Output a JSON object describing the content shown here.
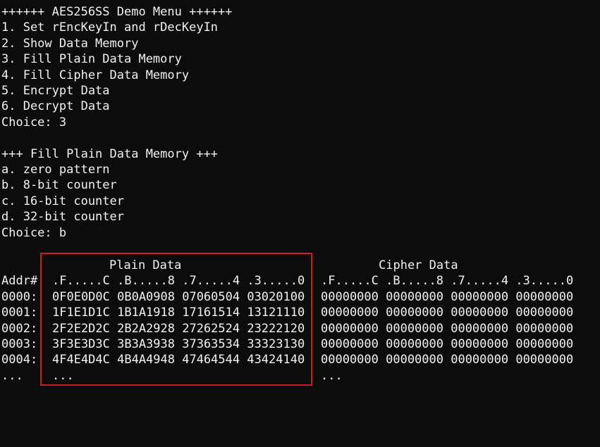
{
  "menu": {
    "title": "++++++ AES256SS Demo Menu ++++++",
    "items": [
      "1. Set rEncKeyIn and rDecKeyIn",
      "2. Show Data Memory",
      "3. Fill Plain Data Memory",
      "4. Fill Cipher Data Memory",
      "5. Encrypt Data",
      "6. Decrypt Data"
    ],
    "choice": "Choice: 3"
  },
  "submenu": {
    "title": "+++ Fill Plain Data Memory +++",
    "items": [
      "a. zero pattern",
      "b. 8-bit counter",
      "c. 16-bit counter",
      "d. 32-bit counter"
    ],
    "choice": "Choice: b"
  },
  "memory": {
    "plain_title": "Plain Data",
    "cipher_title": "Cipher Data",
    "addr_header": "Addr#",
    "plain_columns_header": ".F.....C .B.....8 .7.....4 .3.....0",
    "cipher_columns_header": ".F.....C .B.....8 .7.....4 .3.....0",
    "rows": [
      {
        "addr": "0000:",
        "plain": "0F0E0D0C 0B0A0908 07060504 03020100",
        "cipher": "00000000 00000000 00000000 00000000"
      },
      {
        "addr": "0001:",
        "plain": "1F1E1D1C 1B1A1918 17161514 13121110",
        "cipher": "00000000 00000000 00000000 00000000"
      },
      {
        "addr": "0002:",
        "plain": "2F2E2D2C 2B2A2928 27262524 23222120",
        "cipher": "00000000 00000000 00000000 00000000"
      },
      {
        "addr": "0003:",
        "plain": "3F3E3D3C 3B3A3938 37363534 33323130",
        "cipher": "00000000 00000000 00000000 00000000"
      },
      {
        "addr": "0004:",
        "plain": "4F4E4D4C 4B4A4948 47464544 43424140",
        "cipher": "00000000 00000000 00000000 00000000"
      }
    ],
    "ellipsis_addr": "...",
    "ellipsis_plain": "...",
    "ellipsis_cipher": "..."
  },
  "colors": {
    "background": "#0c0c0c",
    "text": "#f2f2f2",
    "highlight_border": "#d11a1a"
  }
}
